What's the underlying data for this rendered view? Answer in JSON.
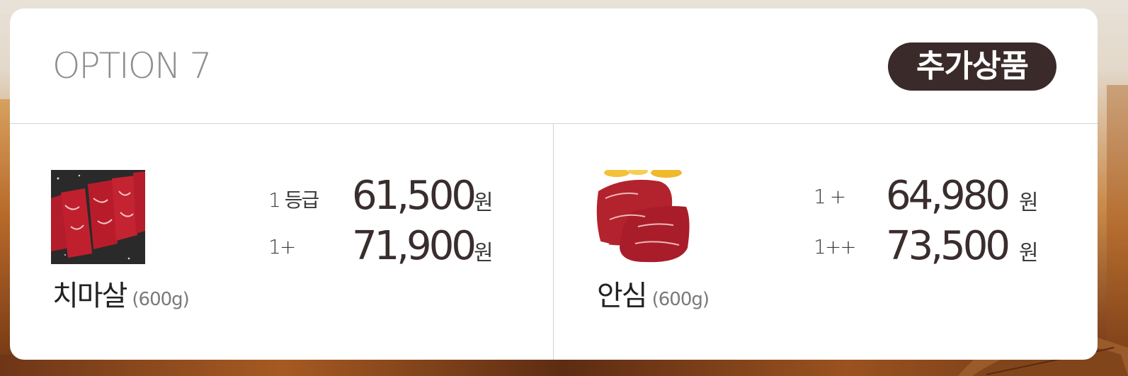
{
  "header": {
    "title": "OPTION 7",
    "badge": "추가상품"
  },
  "products": [
    {
      "name": "치마살",
      "weight": "(600g)",
      "prices": [
        {
          "grade": "1 등급",
          "amount": "61,500",
          "unit": "원"
        },
        {
          "grade": "1+",
          "amount": "71,900",
          "unit": "원"
        }
      ]
    },
    {
      "name": "안심",
      "weight": "(600g)",
      "prices": [
        {
          "grade": "1 +",
          "amount": "64,980",
          "unit": "원"
        },
        {
          "grade": "1++",
          "amount": "73,500",
          "unit": "원"
        }
      ]
    }
  ],
  "colors": {
    "badge_bg": "#3a2a2a",
    "title_gray": "#8e8e8e",
    "price_dark": "#3a2d2d"
  }
}
